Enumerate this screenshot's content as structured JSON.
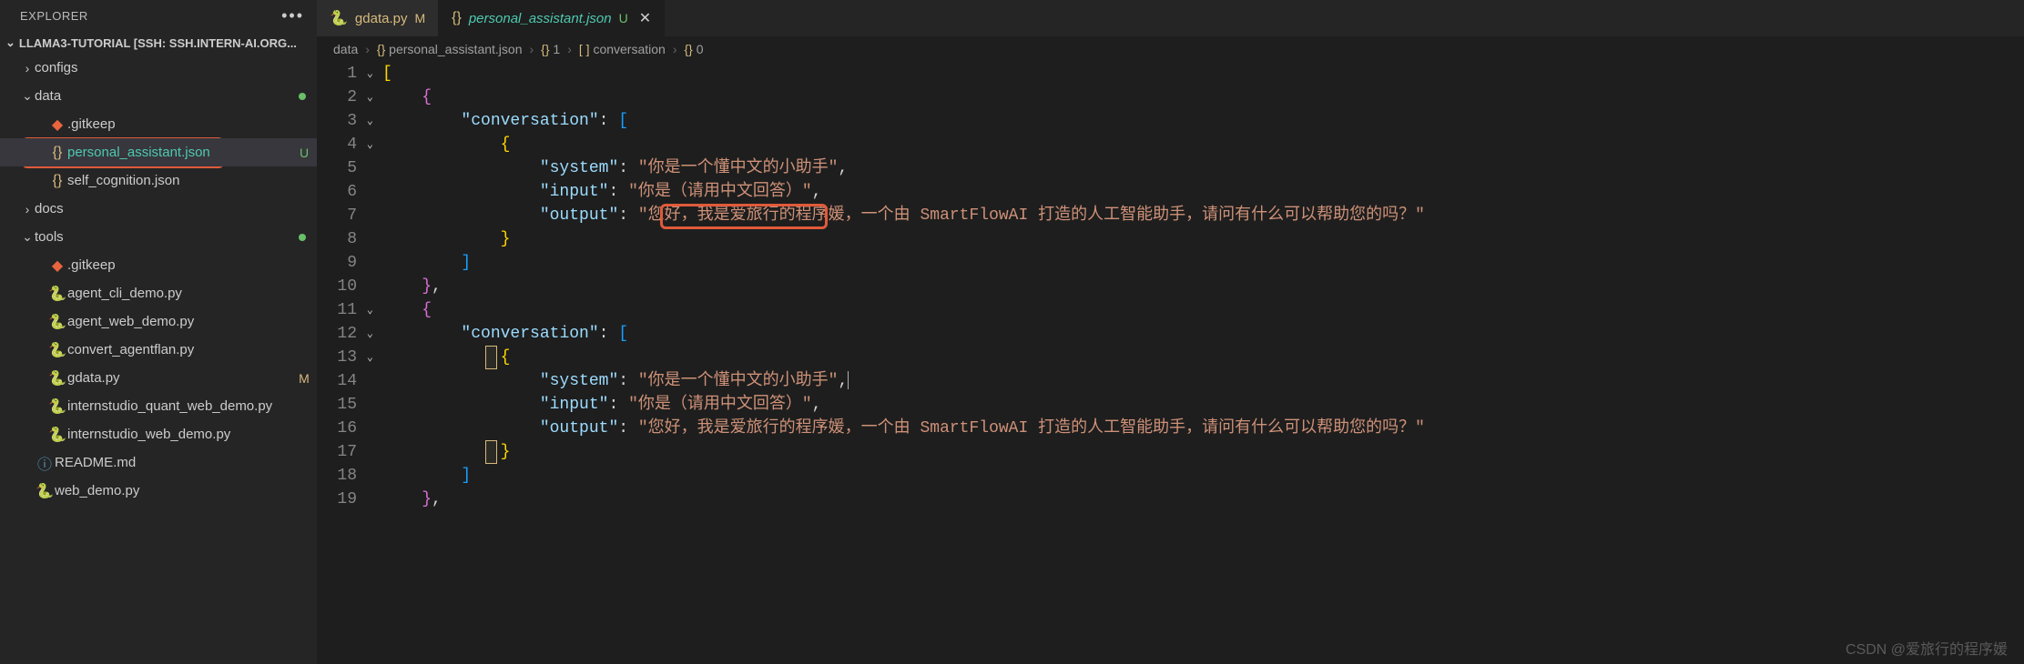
{
  "sidebar": {
    "title": "EXPLORER",
    "project": "LLAMA3-TUTORIAL [SSH: SSH.INTERN-AI.ORG...",
    "items": [
      {
        "type": "folder",
        "label": "configs",
        "expanded": false,
        "indent": 1
      },
      {
        "type": "folder",
        "label": "data",
        "expanded": true,
        "indent": 1,
        "dot": true
      },
      {
        "type": "file",
        "icon": "git",
        "label": ".gitkeep",
        "indent": 2
      },
      {
        "type": "file",
        "icon": "json",
        "label": "personal_assistant.json",
        "indent": 2,
        "badge": "U",
        "active": true
      },
      {
        "type": "file",
        "icon": "json",
        "label": "self_cognition.json",
        "indent": 2
      },
      {
        "type": "folder",
        "label": "docs",
        "expanded": false,
        "indent": 1
      },
      {
        "type": "folder",
        "label": "tools",
        "expanded": true,
        "indent": 1,
        "dot": true
      },
      {
        "type": "file",
        "icon": "git",
        "label": ".gitkeep",
        "indent": 2
      },
      {
        "type": "file",
        "icon": "py",
        "label": "agent_cli_demo.py",
        "indent": 2
      },
      {
        "type": "file",
        "icon": "py",
        "label": "agent_web_demo.py",
        "indent": 2
      },
      {
        "type": "file",
        "icon": "py",
        "label": "convert_agentflan.py",
        "indent": 2
      },
      {
        "type": "file",
        "icon": "py",
        "label": "gdata.py",
        "indent": 2,
        "badge": "M"
      },
      {
        "type": "file",
        "icon": "py",
        "label": "internstudio_quant_web_demo.py",
        "indent": 2
      },
      {
        "type": "file",
        "icon": "py",
        "label": "internstudio_web_demo.py",
        "indent": 2
      },
      {
        "type": "file",
        "icon": "md",
        "label": "README.md",
        "indent": 1
      },
      {
        "type": "file",
        "icon": "py",
        "label": "web_demo.py",
        "indent": 1
      }
    ]
  },
  "tabs": [
    {
      "icon": "py",
      "name": "gdata.py",
      "status": "M",
      "active": false
    },
    {
      "icon": "json",
      "name": "personal_assistant.json",
      "status": "U",
      "active": true,
      "closable": true
    }
  ],
  "breadcrumb": [
    {
      "label": "data"
    },
    {
      "icon": "{}",
      "label": "personal_assistant.json"
    },
    {
      "icon": "{}",
      "label": "1"
    },
    {
      "icon": "[ ]",
      "label": "conversation"
    },
    {
      "icon": "{}",
      "label": "0"
    }
  ],
  "code": {
    "lines": [
      "1",
      "2",
      "3",
      "4",
      "5",
      "6",
      "7",
      "8",
      "9",
      "10",
      "11",
      "12",
      "13",
      "14",
      "15",
      "16",
      "17",
      "18",
      "19"
    ],
    "json": {
      "system": "你是一个懂中文的小助手",
      "input": "你是（请用中文回答）",
      "output": "您好，我是爱旅行的程序媛，一个由 SmartFlowAI 打造的人工智能助手，请问有什么可以帮助您的吗？"
    },
    "highlight_text": "我是爱旅行的程序媛，"
  },
  "watermark": "CSDN @爱旅行的程序媛"
}
